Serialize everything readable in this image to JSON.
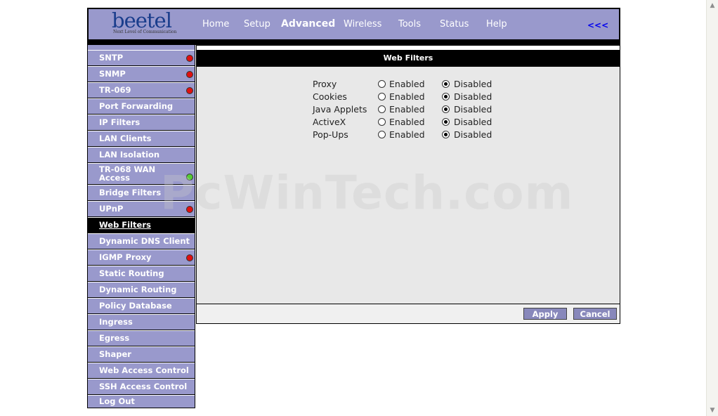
{
  "logo": {
    "word": "beetel",
    "tagline": "Next Level of Communication"
  },
  "nav": {
    "items": [
      {
        "label": "Home"
      },
      {
        "label": "Setup"
      },
      {
        "label": "Advanced"
      },
      {
        "label": "Wireless"
      },
      {
        "label": "Tools"
      },
      {
        "label": "Status"
      },
      {
        "label": "Help"
      }
    ],
    "active": "Advanced",
    "back_label": "<<<"
  },
  "sidebar": {
    "items": [
      {
        "label": "SNTP",
        "status": "red"
      },
      {
        "label": "SNMP",
        "status": "red"
      },
      {
        "label": "TR-069",
        "status": "red"
      },
      {
        "label": "Port Forwarding",
        "status": ""
      },
      {
        "label": "IP Filters",
        "status": ""
      },
      {
        "label": "LAN Clients",
        "status": ""
      },
      {
        "label": "LAN Isolation",
        "status": ""
      },
      {
        "label": "TR-068 WAN Access",
        "status": "green"
      },
      {
        "label": "Bridge Filters",
        "status": ""
      },
      {
        "label": "UPnP",
        "status": "red"
      },
      {
        "label": "Web Filters",
        "status": "",
        "active": true
      },
      {
        "label": "Dynamic DNS Client",
        "status": ""
      },
      {
        "label": "IGMP Proxy",
        "status": "red"
      },
      {
        "label": "Static Routing",
        "status": ""
      },
      {
        "label": "Dynamic Routing",
        "status": ""
      },
      {
        "label": "Policy Database",
        "status": ""
      },
      {
        "label": "Ingress",
        "status": ""
      },
      {
        "label": "Egress",
        "status": ""
      },
      {
        "label": "Shaper",
        "status": ""
      },
      {
        "label": "Web Access Control",
        "status": ""
      },
      {
        "label": "SSH Access Control",
        "status": ""
      },
      {
        "label": "Log Out",
        "status": ""
      }
    ]
  },
  "panel": {
    "title": "Web Filters",
    "enabled_label": "Enabled",
    "disabled_label": "Disabled",
    "filters": [
      {
        "label": "Proxy",
        "value": "Disabled"
      },
      {
        "label": "Cookies",
        "value": "Disabled"
      },
      {
        "label": "Java Applets",
        "value": "Disabled"
      },
      {
        "label": "ActiveX",
        "value": "Disabled"
      },
      {
        "label": "Pop-Ups",
        "value": "Disabled"
      }
    ],
    "apply_label": "Apply",
    "cancel_label": "Cancel"
  },
  "watermark": "PcWinTech.com",
  "colors": {
    "nav_bg": "#9999cc",
    "sidebar_active": "#000000",
    "button_bg": "#8888bb",
    "link_blue": "#0000ee",
    "status_red": "#e01010",
    "status_green": "#55cc33"
  }
}
